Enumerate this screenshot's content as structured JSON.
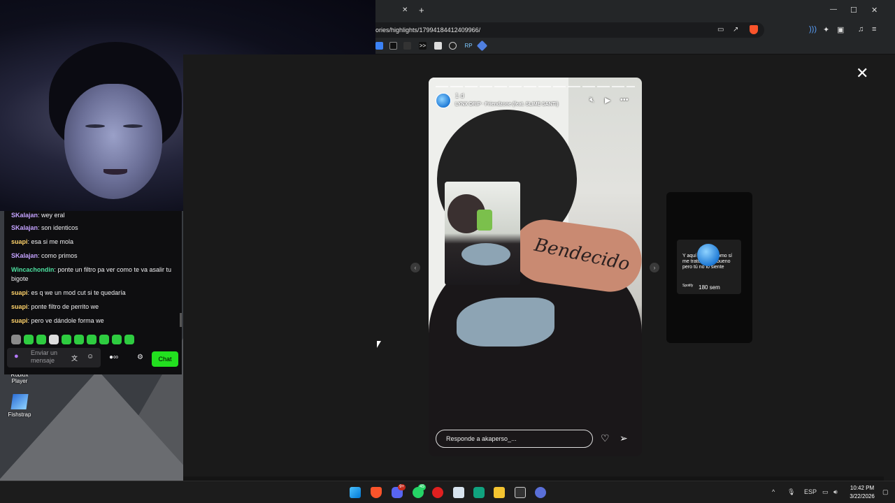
{
  "browser": {
    "url": "ories/highlights/17994184412409966/",
    "new_tab_label": "+",
    "tab_close": "✕",
    "window_controls": {
      "minimize": "—",
      "maximize": "☐",
      "close": "✕"
    },
    "bookmarks": [
      ">>",
      "RP"
    ]
  },
  "story": {
    "time": "1 d",
    "song": "LYNX DRIP · Friendzone (feat. SLIME SANTI)",
    "reply_placeholder": "Responde a akaperso_...",
    "tattoo_text": "Bendecido"
  },
  "next_story": {
    "text": "Y aquí te igual como sí me trato de ser bueno pero tú no lo siente",
    "source": "Spotify",
    "age": "180 sem"
  },
  "chat": {
    "messages": [
      {
        "user": "SKalajan",
        "color": "#c5a3ff",
        "text": "wey eral"
      },
      {
        "user": "SKalajan",
        "color": "#c5a3ff",
        "text": "son identicos"
      },
      {
        "user": "suapi",
        "color": "#ffd36b",
        "text": "esa si me mola"
      },
      {
        "user": "SKalajan",
        "color": "#c5a3ff",
        "text": "como primos"
      },
      {
        "user": "Wincachondin",
        "color": "#4de0a0",
        "text": "ponte un filtro pa ver como te va asalir tu bigote"
      },
      {
        "user": "suapi",
        "color": "#ffd36b",
        "text": "es q we un mod cut si te quedaría"
      },
      {
        "user": "suapi",
        "color": "#ffd36b",
        "text": "ponte filtro de perrito we"
      },
      {
        "user": "suapi",
        "color": "#ffd36b",
        "text": "pero ve dándole forma we"
      }
    ],
    "input_placeholder": "Enviar un mensaje",
    "chat_button": "Chat"
  },
  "desktop": {
    "icons": [
      {
        "label": "Roblox Player"
      },
      {
        "label": "Fishstrap"
      }
    ]
  },
  "taskbar": {
    "lang": "ESP",
    "time": "10:42 PM",
    "date": "3/22/2026",
    "discord_badge": "9+",
    "whatsapp_badge": "45"
  },
  "colors": {
    "chat_button": "#22e01f",
    "emote_green": "#2ecc40"
  }
}
